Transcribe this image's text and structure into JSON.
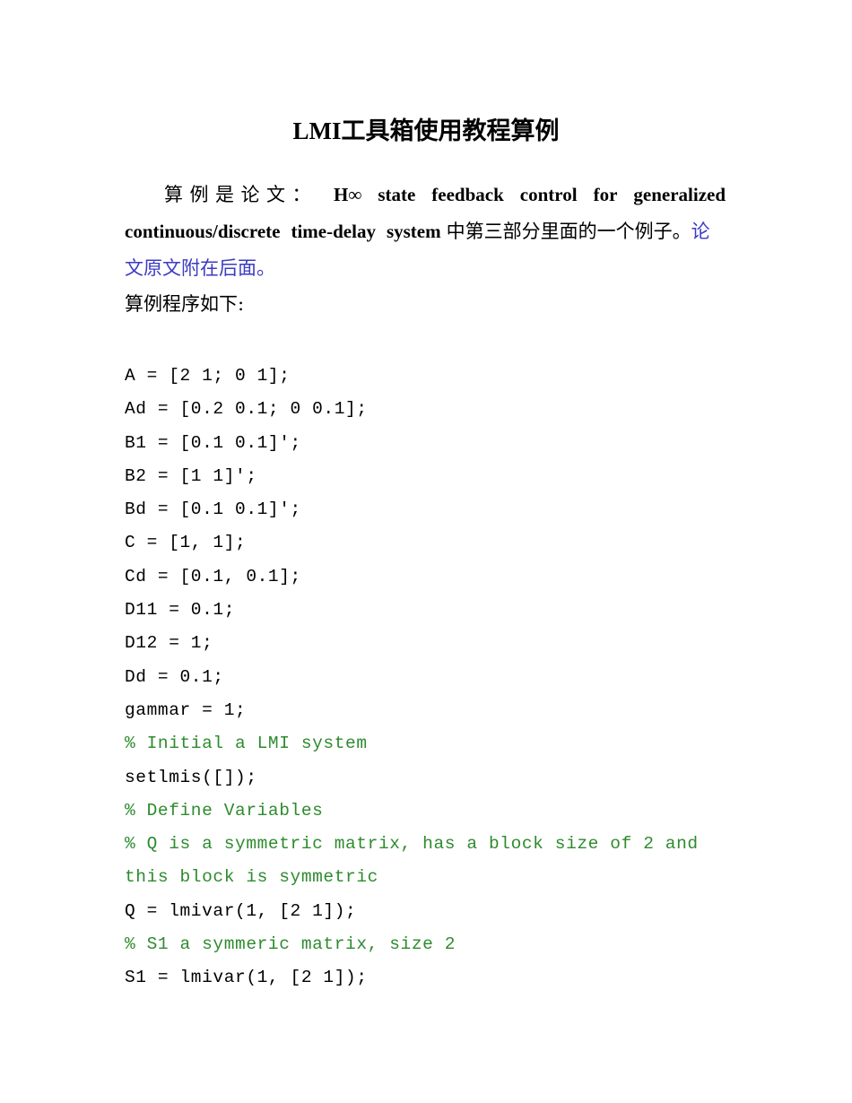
{
  "document": {
    "title": "LMI工具箱使用教程算例",
    "intro": {
      "line1_cn_lead": "算例是论文：",
      "line1_en": [
        "H∞",
        "state",
        "feedback",
        "control",
        "for",
        "generalized"
      ],
      "line2_en": [
        "continuous/discrete",
        "time-delay",
        "system"
      ],
      "line2_cn": "中第三部分里面的一个例子。",
      "line2_blue_tail": "论",
      "line3_blue": "文原文附在后面。",
      "blue_color": "#3b3bc4"
    },
    "program_lead": "算例程序如下:",
    "code": {
      "comment_color": "#2e8b2e",
      "lines": [
        {
          "text": "A = [2 1; 0 1];",
          "type": "code"
        },
        {
          "text": "Ad = [0.2 0.1; 0 0.1];",
          "type": "code"
        },
        {
          "text": "B1 = [0.1 0.1]';",
          "type": "code"
        },
        {
          "text": "B2 = [1 1]';",
          "type": "code"
        },
        {
          "text": "Bd = [0.1 0.1]';",
          "type": "code"
        },
        {
          "text": "C = [1, 1];",
          "type": "code"
        },
        {
          "text": "Cd = [0.1, 0.1];",
          "type": "code"
        },
        {
          "text": "D11 = 0.1;",
          "type": "code"
        },
        {
          "text": "D12 = 1;",
          "type": "code"
        },
        {
          "text": "Dd = 0.1;",
          "type": "code"
        },
        {
          "text": "gammar = 1;",
          "type": "code"
        },
        {
          "text": "% Initial a LMI system",
          "type": "comment"
        },
        {
          "text": "setlmis([]);",
          "type": "code"
        },
        {
          "text": "% Define Variables",
          "type": "comment"
        },
        {
          "text": "% Q is a symmetric matrix, has a block size of 2 and",
          "type": "comment"
        },
        {
          "text": "this block is symmetric",
          "type": "comment"
        },
        {
          "text": "Q = lmivar(1, [2 1]);",
          "type": "code"
        },
        {
          "text": "% S1 a symmeric matrix, size 2",
          "type": "comment"
        },
        {
          "text": "S1 = lmivar(1, [2 1]);",
          "type": "code"
        }
      ]
    }
  }
}
